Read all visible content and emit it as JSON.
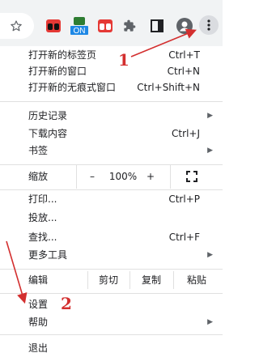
{
  "toolbar": {
    "icons": [
      "star-icon",
      "extension-red-black-icon",
      "extension-on-icon",
      "extension-red-icon",
      "puzzle-icon",
      "sidepanel-icon",
      "profile-icon",
      "more-icon"
    ],
    "ext_badge": "ON"
  },
  "menu": {
    "new_tab": {
      "label": "打开新的标签页",
      "shortcut": "Ctrl+T"
    },
    "new_window": {
      "label": "打开新的窗口",
      "shortcut": "Ctrl+N"
    },
    "incognito": {
      "label": "打开新的无痕式窗口",
      "shortcut": "Ctrl+Shift+N"
    },
    "history": {
      "label": "历史记录"
    },
    "downloads": {
      "label": "下载内容",
      "shortcut": "Ctrl+J"
    },
    "bookmarks": {
      "label": "书签"
    },
    "zoom": {
      "label": "缩放",
      "minus": "–",
      "value": "100%",
      "plus": "+"
    },
    "print": {
      "label": "打印...",
      "shortcut": "Ctrl+P"
    },
    "cast": {
      "label": "投放..."
    },
    "find": {
      "label": "查找...",
      "shortcut": "Ctrl+F"
    },
    "more_tools": {
      "label": "更多工具"
    },
    "edit": {
      "label": "编辑",
      "cut": "剪切",
      "copy": "复制",
      "paste": "粘贴"
    },
    "settings": {
      "label": "设置"
    },
    "help": {
      "label": "帮助"
    },
    "exit": {
      "label": "退出"
    }
  },
  "annotations": {
    "step1": "1",
    "step2": "2",
    "color": "#d32f2f"
  }
}
